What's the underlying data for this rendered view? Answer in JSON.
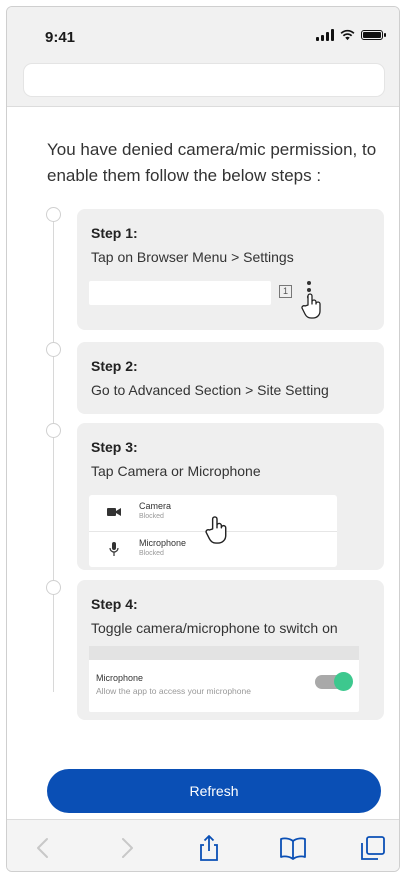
{
  "status_bar": {
    "time": "9:41"
  },
  "heading": "You have denied camera/mic permission, to enable them follow the below steps :",
  "steps": [
    {
      "title": "Step 1:",
      "description": "Tap on Browser Menu > Settings",
      "illustration": {
        "tab_count": "1"
      }
    },
    {
      "title": "Step 2:",
      "description": "Go to Advanced Section > Site Setting"
    },
    {
      "title": "Step 3:",
      "description": "Tap Camera or Microphone",
      "permissions": [
        {
          "name": "Camera",
          "status": "Blocked",
          "icon": "camera-icon"
        },
        {
          "name": "Microphone",
          "status": "Blocked",
          "icon": "microphone-icon"
        }
      ]
    },
    {
      "title": "Step 4:",
      "description": "Toggle camera/microphone to switch on",
      "toggle": {
        "title": "Microphone",
        "subtitle": "Allow the app to access your microphone",
        "on": true
      }
    }
  ],
  "refresh_label": "Refresh",
  "colors": {
    "primary": "#0a4fb5",
    "toggle_on": "#3dc88e",
    "card_bg": "#efefef"
  },
  "bottom_bar_icons": [
    "back-icon",
    "forward-icon",
    "share-icon",
    "bookmarks-icon",
    "tabs-icon"
  ]
}
